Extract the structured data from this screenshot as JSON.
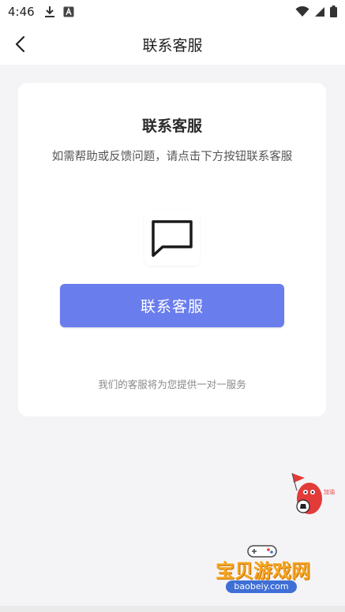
{
  "status_bar": {
    "time": "4:46",
    "left_icons": [
      "download-icon",
      "text-a-icon"
    ],
    "right_icons": [
      "wifi-icon",
      "signal-icon",
      "battery-icon"
    ]
  },
  "header": {
    "title": "联系客服",
    "back_icon": "chevron-left-icon"
  },
  "card": {
    "title": "联系客服",
    "subtitle": "如需帮助或反馈问题，请点击下方按钮联系客服",
    "icon": "chat-bubble-icon",
    "button_label": "联系客服",
    "note": "我们的客服将为您提供一对一服务"
  },
  "watermark": {
    "name": "宝贝游戏网",
    "url": "baobeiy.com"
  },
  "colors": {
    "accent": "#6a7ded",
    "background": "#f4f4f6",
    "card": "#ffffff"
  }
}
